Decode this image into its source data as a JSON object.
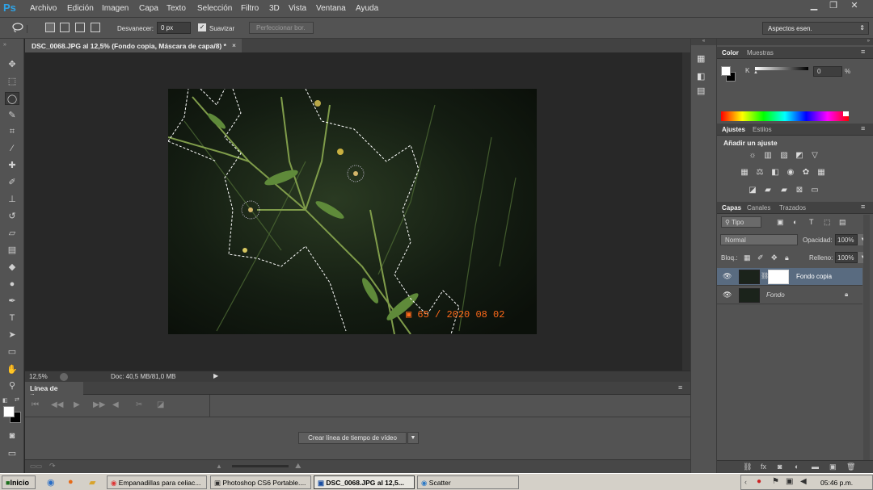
{
  "app": {
    "logo": "Ps"
  },
  "menu": [
    "Archivo",
    "Edición",
    "Imagen",
    "Capa",
    "Texto",
    "Selección",
    "Filtro",
    "3D",
    "Vista",
    "Ventana",
    "Ayuda"
  ],
  "window_buttons": {
    "minimize": "▁",
    "restore": "❐",
    "close": "✕"
  },
  "options": {
    "feather_label": "Desvanecer:",
    "feather_value": "0 px",
    "antialias_label": "Suavizar",
    "refine_edge": "Perfeccionar bor.",
    "workspace": "Aspectos esen."
  },
  "document": {
    "tab_title": "DSC_0068.JPG al 12,5% (Fondo copia, Máscara de capa/8) *",
    "close": "×",
    "zoom": "12,5%",
    "doc_size": "Doc: 40,5 MB/81,0 MB",
    "date_stamp_prefix": "▣ 65",
    "date_stamp": "2020 08 02"
  },
  "timeline": {
    "title": "Línea de tiempo",
    "create_button": "Crear línea de tiempo de vídeo"
  },
  "color_panel": {
    "tabs": [
      "Color",
      "Muestras"
    ],
    "channel_label": "K",
    "value": "0",
    "unit": "%"
  },
  "adjust_panel": {
    "tabs": [
      "Ajustes",
      "Estilos"
    ],
    "heading": "Añadir un ajuste"
  },
  "layers_panel": {
    "tabs": [
      "Capas",
      "Canales",
      "Trazados"
    ],
    "filter": "Tipo",
    "blend_mode": "Normal",
    "opacity_label": "Opacidad:",
    "opacity_value": "100%",
    "lock_label": "Bloq.:",
    "fill_label": "Relleno:",
    "fill_value": "100%",
    "layers": [
      {
        "name": "Fondo copia"
      },
      {
        "name": "Fondo"
      }
    ]
  },
  "taskbar": {
    "start": "Inicio",
    "tasks": [
      "Empanadillas para celiac...",
      "Photoshop CS6 Portable....",
      "DSC_0068.JPG al 12,5...",
      "Scatter"
    ],
    "clock": "05:46 p.m."
  }
}
